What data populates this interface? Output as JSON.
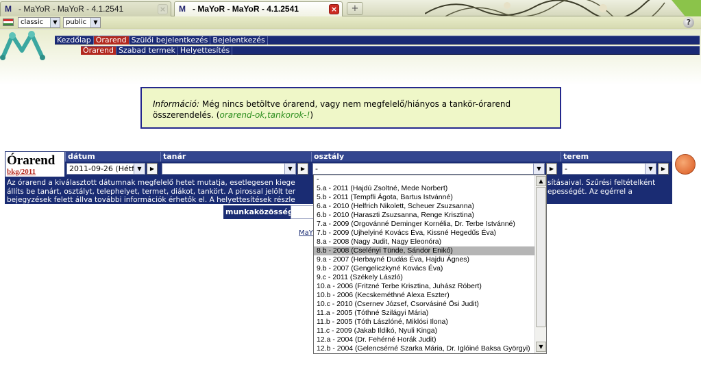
{
  "browser": {
    "tabs": [
      {
        "favicon": "M",
        "title": "- MaYoR - MaYoR - 4.1.2541",
        "close": "×"
      },
      {
        "favicon": "M",
        "title": "- MaYoR - MaYoR - 4.1.2541",
        "close": "×"
      }
    ],
    "new_tab": "+"
  },
  "toolbar": {
    "flag_icon": "hungarian-flag-icon",
    "skin_select": "classic",
    "policy_select": "public",
    "help_icon": "?"
  },
  "nav": {
    "main": [
      {
        "label": "Kezdőlap",
        "current": false
      },
      {
        "label": "Órarend",
        "current": true
      },
      {
        "label": "Szülői bejelentkezés",
        "current": false
      },
      {
        "label": "Bejelentkezés",
        "current": false
      }
    ],
    "sub": [
      {
        "label": "Órarend",
        "current": true
      },
      {
        "label": "Szabad termek",
        "current": false
      },
      {
        "label": "Helyettesítés",
        "current": false
      }
    ]
  },
  "info": {
    "lead": "Információ:",
    "text1": " Még nincs betöltve órarend, vagy nem megfelelő/hiányos a tankör-órarend",
    "text2": "összerendelés. (",
    "link": "orarend-ok,tankorok-!",
    "text3": ")"
  },
  "filter": {
    "title": "Órarend",
    "subtitle": "bkg/2011",
    "labels": {
      "datum": "dátum",
      "tanar": "tanár",
      "osztaly": "osztály",
      "terem": "terem"
    },
    "values": {
      "datum": "2011-09-26 (Hétfő)",
      "tanar": "",
      "osztaly": "-",
      "terem": "-"
    },
    "go": "▶",
    "help_lines": [
      "Az órarend a kiválasztott dátumnak megfelelő hetet mutatja, esetlegesen kiege",
      "állíts be tanárt, osztályt, telephelyet, termet, diákot, tankört. A pirossal jelölt ter",
      "bejegyzések felett állva további információk érhetők el. A helyettesítések részle"
    ],
    "help_tail": [
      "sításaival. Szűrési feltételként",
      "epességét. Az egérrel a",
      ""
    ]
  },
  "munkakozosseg": {
    "label": "munkaközösség"
  },
  "footer": {
    "link": "MaY"
  },
  "dropdown": {
    "selected_index": 8,
    "options": [
      "-",
      "5.a - 2011 (Hajdú Zsoltné, Mede Norbert)",
      "5.b - 2011 (Tempfli Ágota, Bartus Istvánné)",
      "6.a - 2010 (Helfrich Nikolett, Scheuer Zsuzsanna)",
      "6.b - 2010 (Haraszti Zsuzsanna, Renge Krisztina)",
      "7.a - 2009 (Orgovánné Deminger Kornélia, Dr. Terbe Istvánné)",
      "7.b - 2009 (Ujhelyiné Kovács Éva, Kissné Hegedűs Éva)",
      "8.a - 2008 (Nagy Judit, Nagy Eleonóra)",
      "8.b - 2008 (Cselényi Tünde, Sándor Enikő)",
      "9.a - 2007 (Herbayné Dudás Éva, Hajdu Ágnes)",
      "9.b - 2007 (Gengeliczkyné Kovács Éva)",
      "9.c - 2011 (Székely László)",
      "10.a - 2006 (Fritzné Terbe Krisztina, Juhász Róbert)",
      "10.b - 2006 (Kecskeméthné Alexa Eszter)",
      "10.c - 2010 (Csernev József, Csorvásiné Ősi Judit)",
      "11.a - 2005 (Tóthné Szilágyi Mária)",
      "11.b - 2005 (Tóth Lászlóné, Miklósi Ilona)",
      "11.c - 2009 (Jakab Ildikó, Nyuli Kinga)",
      "12.a - 2004 (Dr. Fehérné Horák Judit)",
      "12.b - 2004 (Gelencsérné Szarka Mária, Dr. Iglóiné Baksa Györgyi)"
    ]
  },
  "colors": {
    "nav_bg": "#1a2a75",
    "nav_current": "#b2281e",
    "info_border": "#23278c",
    "info_bg": "#eff7c8",
    "accent_red": "#b3281e"
  }
}
